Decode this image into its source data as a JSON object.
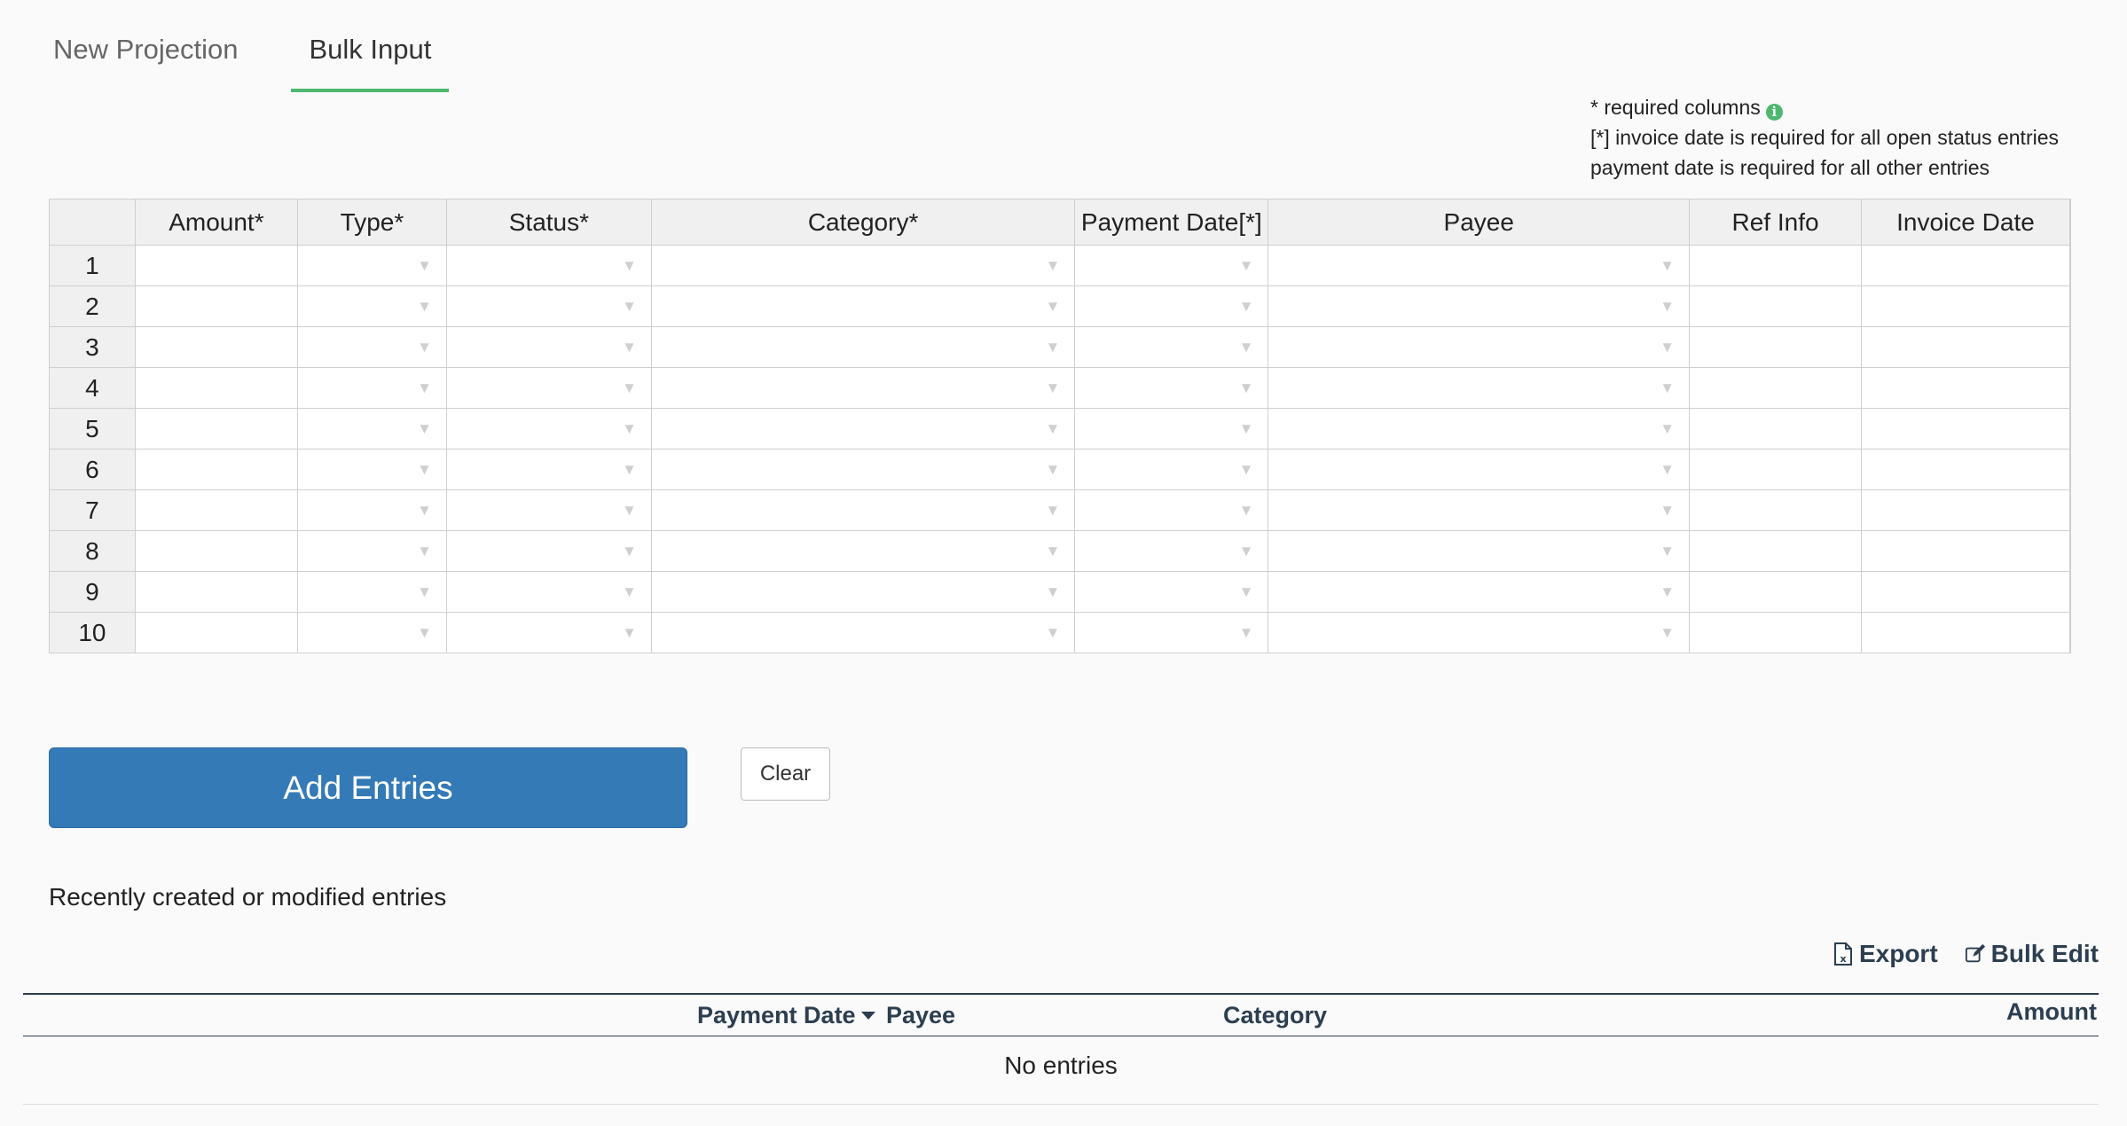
{
  "tabs": [
    {
      "label": "New Projection",
      "active": false
    },
    {
      "label": "Bulk Input",
      "active": true
    }
  ],
  "notes": {
    "line1": "* required columns",
    "line2": "[*] invoice date is required for all open status entries",
    "line3": "payment date is required for all other entries"
  },
  "grid": {
    "columns": [
      {
        "label": "Amount*",
        "dropdown": false
      },
      {
        "label": "Type*",
        "dropdown": true
      },
      {
        "label": "Status*",
        "dropdown": true
      },
      {
        "label": "Category*",
        "dropdown": true
      },
      {
        "label": "Payment Date[*]",
        "dropdown": true
      },
      {
        "label": "Payee",
        "dropdown": true
      },
      {
        "label": "Ref Info",
        "dropdown": false
      },
      {
        "label": "Invoice Date",
        "dropdown": false
      }
    ],
    "rows": [
      "1",
      "2",
      "3",
      "4",
      "5",
      "6",
      "7",
      "8",
      "9",
      "10"
    ]
  },
  "buttons": {
    "add_entries": "Add Entries",
    "clear": "Clear"
  },
  "recent": {
    "title": "Recently created or modified entries",
    "export_label": "Export",
    "bulk_edit_label": "Bulk Edit",
    "columns": {
      "payment_date": "Payment Date",
      "payee": "Payee",
      "category": "Category",
      "amount": "Amount"
    },
    "empty_text": "No entries"
  },
  "colors": {
    "accent_green": "#4db86f",
    "primary_blue": "#337ab7",
    "header_navy": "#2c3e50"
  },
  "icons": {
    "info": "info-icon",
    "export": "excel-file-icon",
    "bulk_edit": "edit-icon",
    "dropdown": "chevron-down-icon",
    "sort": "sort-desc-caret-icon"
  }
}
